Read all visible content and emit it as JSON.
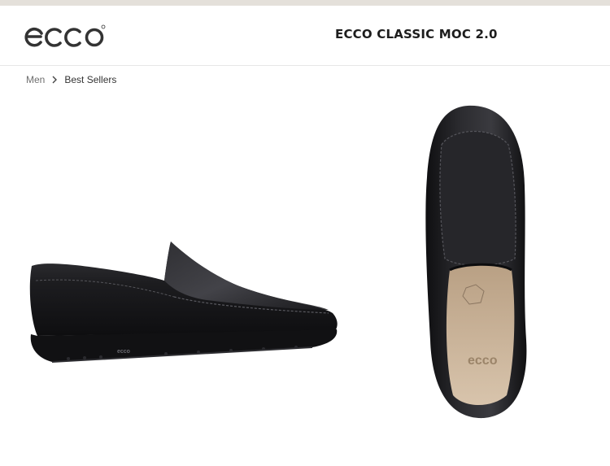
{
  "brand": {
    "logo_text": "ecco"
  },
  "product": {
    "title": "ECCO CLASSIC MOC 2.0"
  },
  "breadcrumb": {
    "items": [
      {
        "label": "Men"
      },
      {
        "label": "Best Sellers"
      }
    ]
  },
  "images": {
    "side_view": {
      "icon": "shoe-side-view"
    },
    "top_view": {
      "icon": "shoe-top-view"
    },
    "sole_lettering": "ecco",
    "insole_lettering": "ecco"
  },
  "colors": {
    "leather": "#1a1a1c",
    "lining": "#c9b39a",
    "top_strip": "#e4e0da"
  }
}
